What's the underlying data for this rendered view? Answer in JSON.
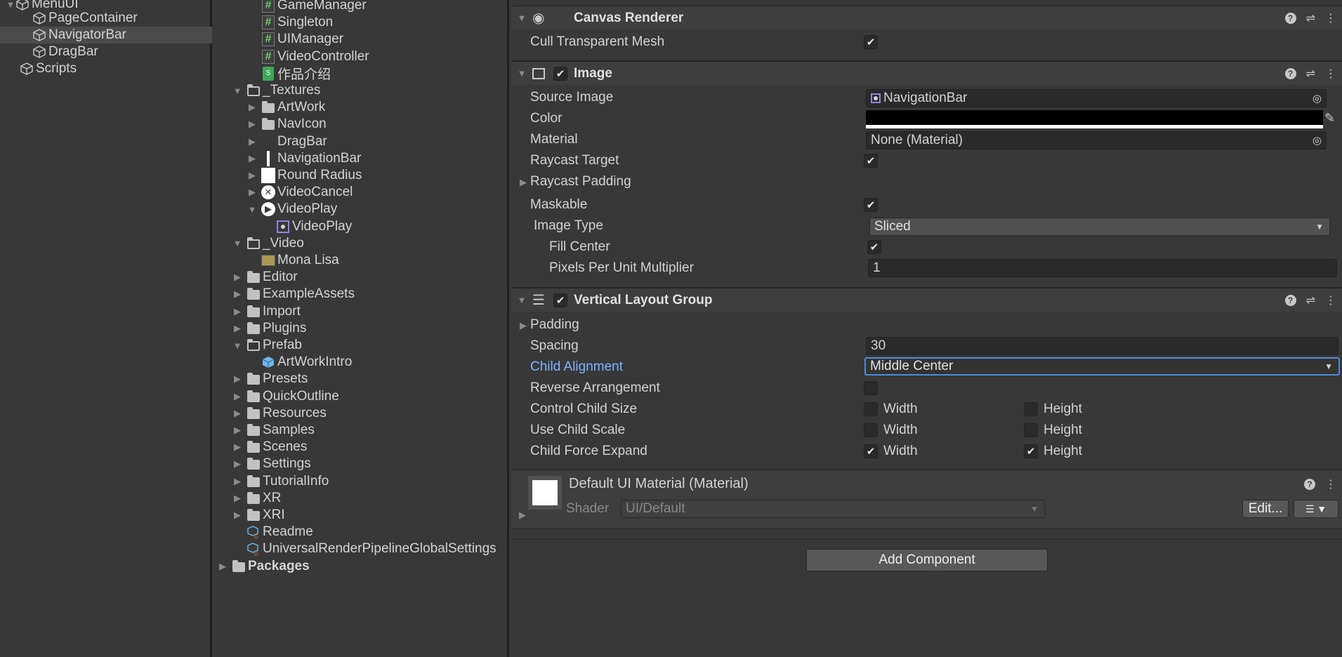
{
  "hierarchy": {
    "items": [
      {
        "label": "MenuUI",
        "indent": 0
      },
      {
        "label": "PageContainer",
        "indent": 1
      },
      {
        "label": "NavigatorBar",
        "indent": 1,
        "selected": true
      },
      {
        "label": "DragBar",
        "indent": 1
      },
      {
        "label": "Scripts",
        "indent": 0
      }
    ]
  },
  "project": {
    "items": [
      {
        "label": "GameManager",
        "icon": "script",
        "indent": 3
      },
      {
        "label": "Singleton",
        "icon": "script",
        "indent": 3
      },
      {
        "label": "UIManager",
        "icon": "script",
        "indent": 3
      },
      {
        "label": "VideoController",
        "icon": "script",
        "indent": 3
      },
      {
        "label": "作品介绍",
        "icon": "sheet",
        "indent": 3
      },
      {
        "label": "_Textures",
        "icon": "folder-open",
        "indent": 2,
        "expanded": true
      },
      {
        "label": "ArtWork",
        "icon": "folder",
        "indent": 3,
        "collapsed": true
      },
      {
        "label": "NavIcon",
        "icon": "folder",
        "indent": 3,
        "collapsed": true
      },
      {
        "label": "DragBar",
        "icon": "none",
        "indent": 3,
        "collapsed": true
      },
      {
        "label": "NavigationBar",
        "icon": "bar",
        "indent": 3,
        "collapsed": true
      },
      {
        "label": "Round Radius",
        "icon": "white-square",
        "indent": 3,
        "collapsed": true
      },
      {
        "label": "VideoCancel",
        "icon": "circle-x",
        "indent": 3,
        "collapsed": true
      },
      {
        "label": "VideoPlay",
        "icon": "circle-play",
        "indent": 3,
        "expanded": true
      },
      {
        "label": "VideoPlay",
        "icon": "sprite",
        "indent": 4
      },
      {
        "label": "_Video",
        "icon": "folder-open",
        "indent": 2,
        "expanded": true
      },
      {
        "label": "Mona Lisa",
        "icon": "video",
        "indent": 3
      },
      {
        "label": "Editor",
        "icon": "folder",
        "indent": 2,
        "collapsed": true
      },
      {
        "label": "ExampleAssets",
        "icon": "folder",
        "indent": 2,
        "collapsed": true
      },
      {
        "label": "Import",
        "icon": "folder",
        "indent": 2,
        "collapsed": true
      },
      {
        "label": "Plugins",
        "icon": "folder",
        "indent": 2,
        "collapsed": true
      },
      {
        "label": "Prefab",
        "icon": "folder-open",
        "indent": 2,
        "expanded": true
      },
      {
        "label": "ArtWorkIntro",
        "icon": "prefab",
        "indent": 3
      },
      {
        "label": "Presets",
        "icon": "folder",
        "indent": 2,
        "collapsed": true
      },
      {
        "label": "QuickOutline",
        "icon": "folder",
        "indent": 2,
        "collapsed": true
      },
      {
        "label": "Resources",
        "icon": "folder",
        "indent": 2,
        "collapsed": true
      },
      {
        "label": "Samples",
        "icon": "folder",
        "indent": 2,
        "collapsed": true
      },
      {
        "label": "Scenes",
        "icon": "folder",
        "indent": 2,
        "collapsed": true
      },
      {
        "label": "Settings",
        "icon": "folder",
        "indent": 2,
        "collapsed": true
      },
      {
        "label": "TutorialInfo",
        "icon": "folder",
        "indent": 2,
        "collapsed": true
      },
      {
        "label": "XR",
        "icon": "folder",
        "indent": 2,
        "collapsed": true
      },
      {
        "label": "XRI",
        "icon": "folder",
        "indent": 2,
        "collapsed": true
      },
      {
        "label": "Readme",
        "icon": "asset",
        "indent": 2
      },
      {
        "label": "UniversalRenderPipelineGlobalSettings",
        "icon": "asset",
        "indent": 2
      },
      {
        "label": "Packages",
        "icon": "folder",
        "indent": 1,
        "collapsed": true,
        "bold": true
      }
    ]
  },
  "inspector": {
    "canvas_renderer": {
      "title": "Canvas Renderer",
      "cull_label": "Cull Transparent Mesh",
      "cull": true
    },
    "image": {
      "title": "Image",
      "source_image_label": "Source Image",
      "source_image": "NavigationBar",
      "color_label": "Color",
      "color_value": "#000000",
      "material_label": "Material",
      "material": "None (Material)",
      "raycast_target_label": "Raycast Target",
      "raycast_padding_label": "Raycast Padding",
      "maskable_label": "Maskable",
      "image_type_label": "Image Type",
      "image_type": "Sliced",
      "fill_center_label": "Fill Center",
      "ppu_label": "Pixels Per Unit Multiplier",
      "ppu": "1"
    },
    "vlg": {
      "title": "Vertical Layout Group",
      "padding_label": "Padding",
      "spacing_label": "Spacing",
      "spacing": "30",
      "child_alignment_label": "Child Alignment",
      "child_alignment": "Middle Center",
      "reverse_label": "Reverse Arrangement",
      "control_size_label": "Control Child Size",
      "use_scale_label": "Use Child Scale",
      "force_expand_label": "Child Force Expand",
      "width_label": "Width",
      "height_label": "Height"
    },
    "material": {
      "title": "Default UI Material (Material)",
      "shader_label": "Shader",
      "shader": "UI/Default",
      "edit_label": "Edit..."
    },
    "add_component_label": "Add Component"
  }
}
